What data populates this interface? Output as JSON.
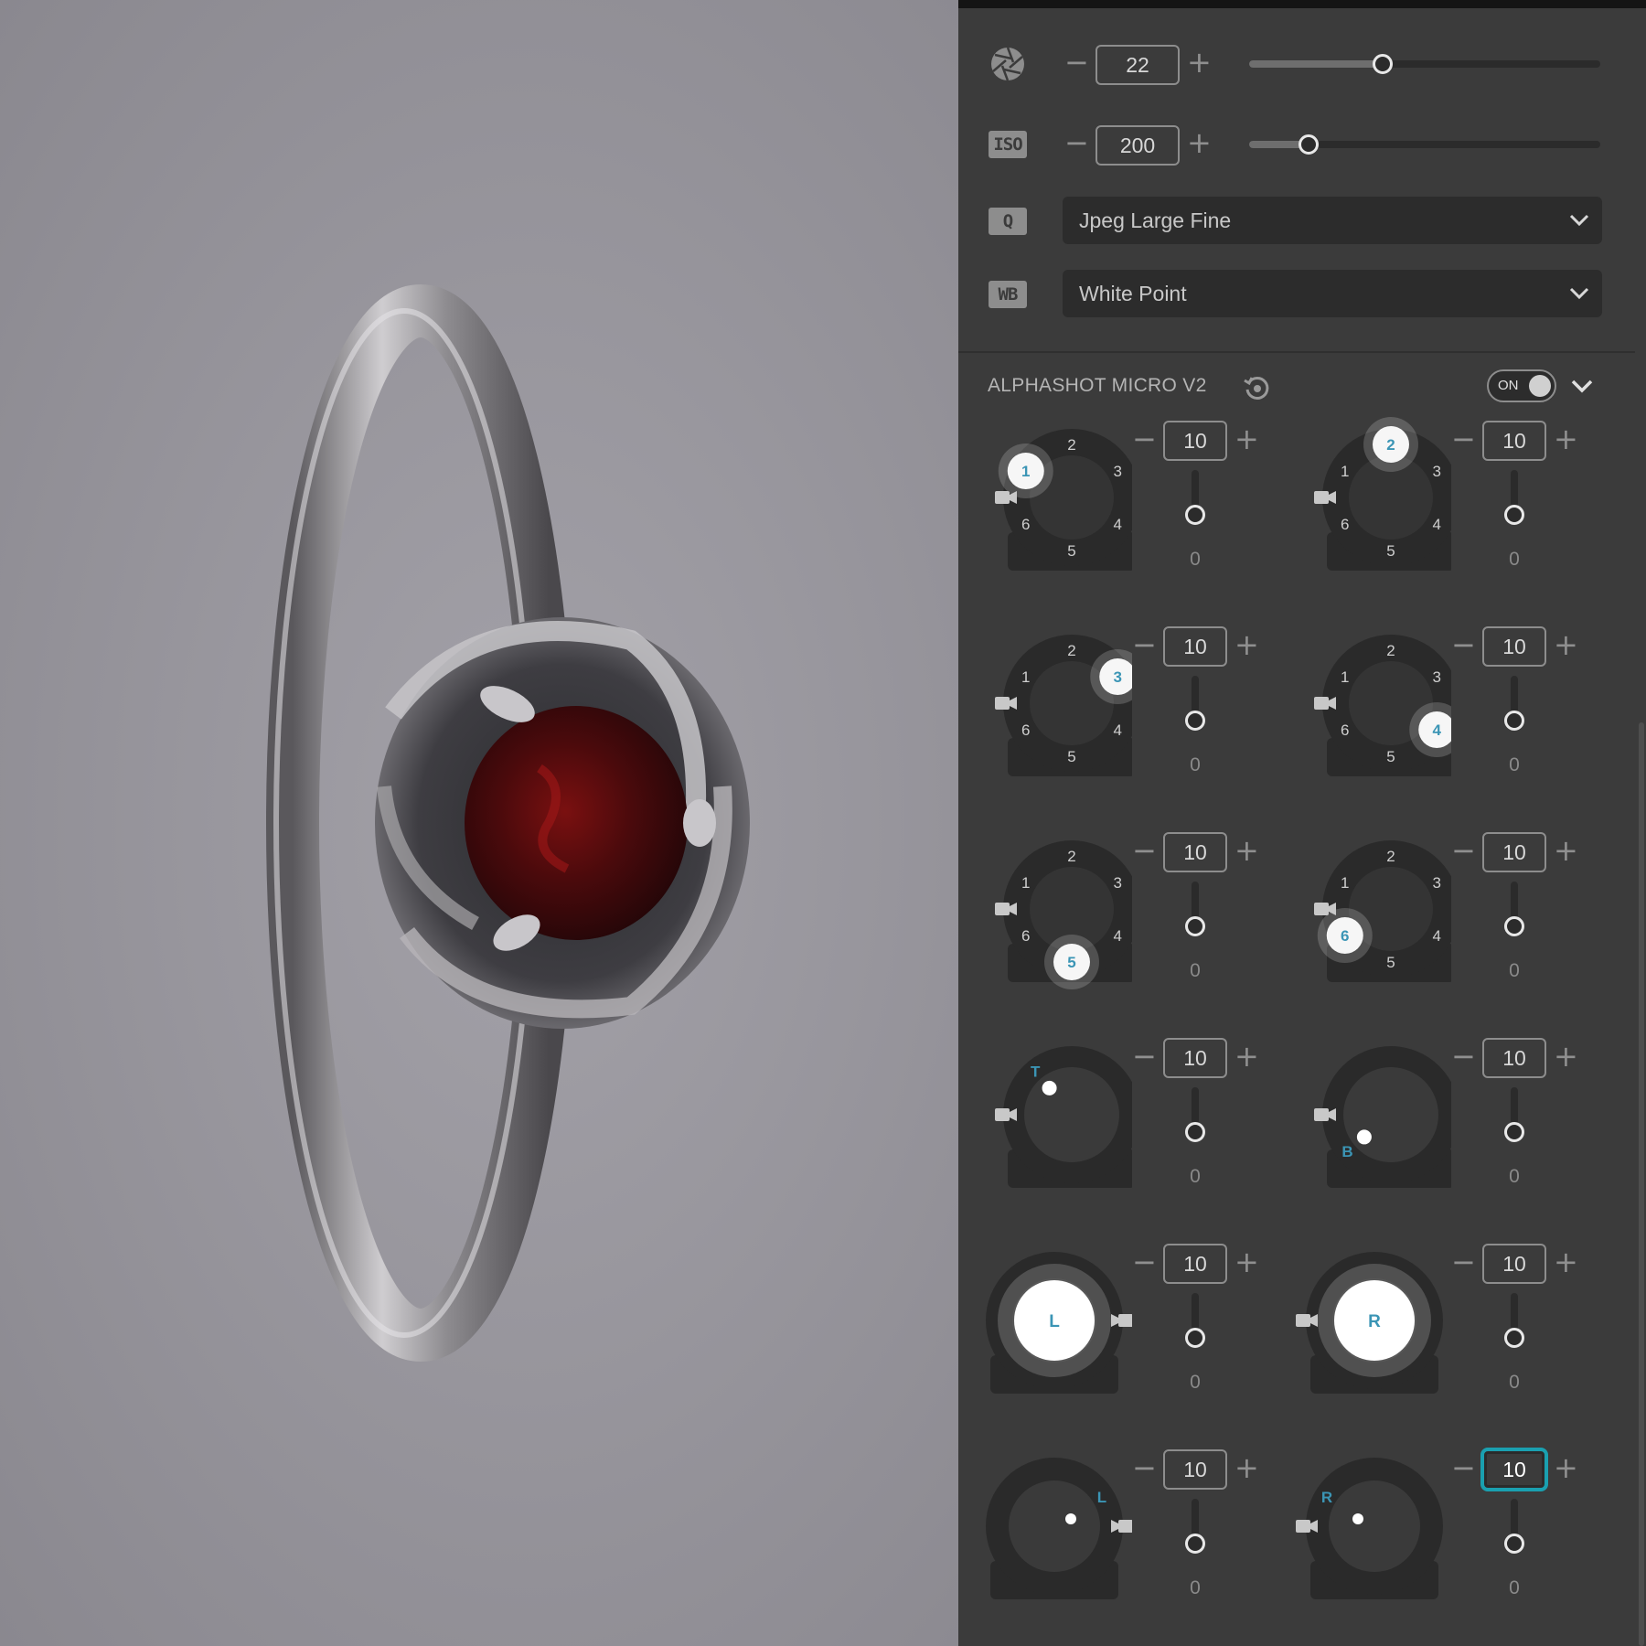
{
  "camera": {
    "aperture": {
      "icon": "aperture-icon",
      "value": "22",
      "slider_fraction": 0.38
    },
    "iso": {
      "icon_label": "ISO",
      "value": "200",
      "slider_fraction": 0.17
    },
    "quality": {
      "icon_label": "Q",
      "selected": "Jpeg Large Fine"
    },
    "white_balance": {
      "icon_label": "WB",
      "selected": "White Point"
    }
  },
  "device": {
    "title": "ALPHASHOT MICRO V2",
    "toggle_label": "ON",
    "toggle_on": true
  },
  "accent_color": "#3b95b5",
  "lights": [
    {
      "type": "ring",
      "active": "1",
      "camera_side": "left",
      "value": "10",
      "slider_value": "0"
    },
    {
      "type": "ring",
      "active": "2",
      "camera_side": "left",
      "value": "10",
      "slider_value": "0"
    },
    {
      "type": "ring",
      "active": "3",
      "camera_side": "left",
      "value": "10",
      "slider_value": "0"
    },
    {
      "type": "ring",
      "active": "4",
      "camera_side": "left",
      "value": "10",
      "slider_value": "0"
    },
    {
      "type": "ring",
      "active": "5",
      "camera_side": "left",
      "value": "10",
      "slider_value": "0"
    },
    {
      "type": "ring",
      "active": "6",
      "camera_side": "left",
      "value": "10",
      "slider_value": "0"
    },
    {
      "type": "spot",
      "label": "T",
      "camera_side": "left",
      "value": "10",
      "slider_value": "0"
    },
    {
      "type": "spot",
      "label": "B",
      "camera_side": "left",
      "value": "10",
      "slider_value": "0"
    },
    {
      "type": "full",
      "label": "L",
      "camera_side": "right",
      "value": "10",
      "slider_value": "0"
    },
    {
      "type": "full",
      "label": "R",
      "camera_side": "left",
      "value": "10",
      "slider_value": "0"
    },
    {
      "type": "side",
      "label": "L",
      "camera_side": "right",
      "value": "10",
      "slider_value": "0"
    },
    {
      "type": "side",
      "label": "R",
      "camera_side": "left",
      "value": "10",
      "slider_value": "0",
      "focused": true
    }
  ],
  "ring_numbers": [
    "1",
    "2",
    "3",
    "4",
    "5",
    "6"
  ]
}
